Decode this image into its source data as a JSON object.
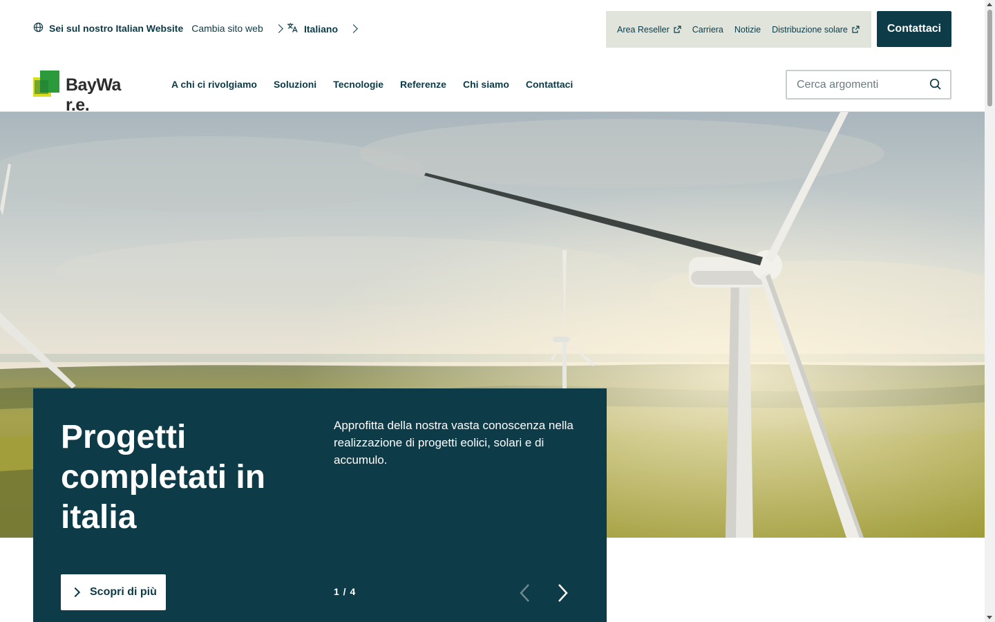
{
  "utility": {
    "site_label": "Sei sul nostro Italian Website",
    "site_change": "Cambia sito web",
    "language": "Italiano",
    "links": [
      {
        "label": "Area Reseller",
        "external": true
      },
      {
        "label": "Carriera",
        "external": false
      },
      {
        "label": "Notizie",
        "external": false
      },
      {
        "label": "Distribuzione solare",
        "external": true
      }
    ],
    "contact_label": "Contattaci"
  },
  "header": {
    "logo_text": "BayWa r.e.",
    "nav": [
      "A chi ci rivolgiamo",
      "Soluzioni",
      "Tecnologie",
      "Referenze",
      "Chi siamo",
      "Contattaci"
    ],
    "search_placeholder": "Cerca argomenti"
  },
  "hero": {
    "title": "Progetti completati in italia",
    "description": "Approfitta della nostra vasta conoscenza nella realizzazione di progetti eolici, solari e di accumulo.",
    "cta_label": "Scopri di più",
    "counter": "1 / 4"
  },
  "colors": {
    "brand_dark": "#0e3b48",
    "util_bg": "#e0e4db",
    "logo_green": "#2a9a3a",
    "logo_yellow": "#d9dc1f"
  },
  "icons": [
    "globe-icon",
    "translate-icon",
    "external-link-icon",
    "search-icon",
    "chevron-right-icon",
    "chevron-left-icon"
  ]
}
